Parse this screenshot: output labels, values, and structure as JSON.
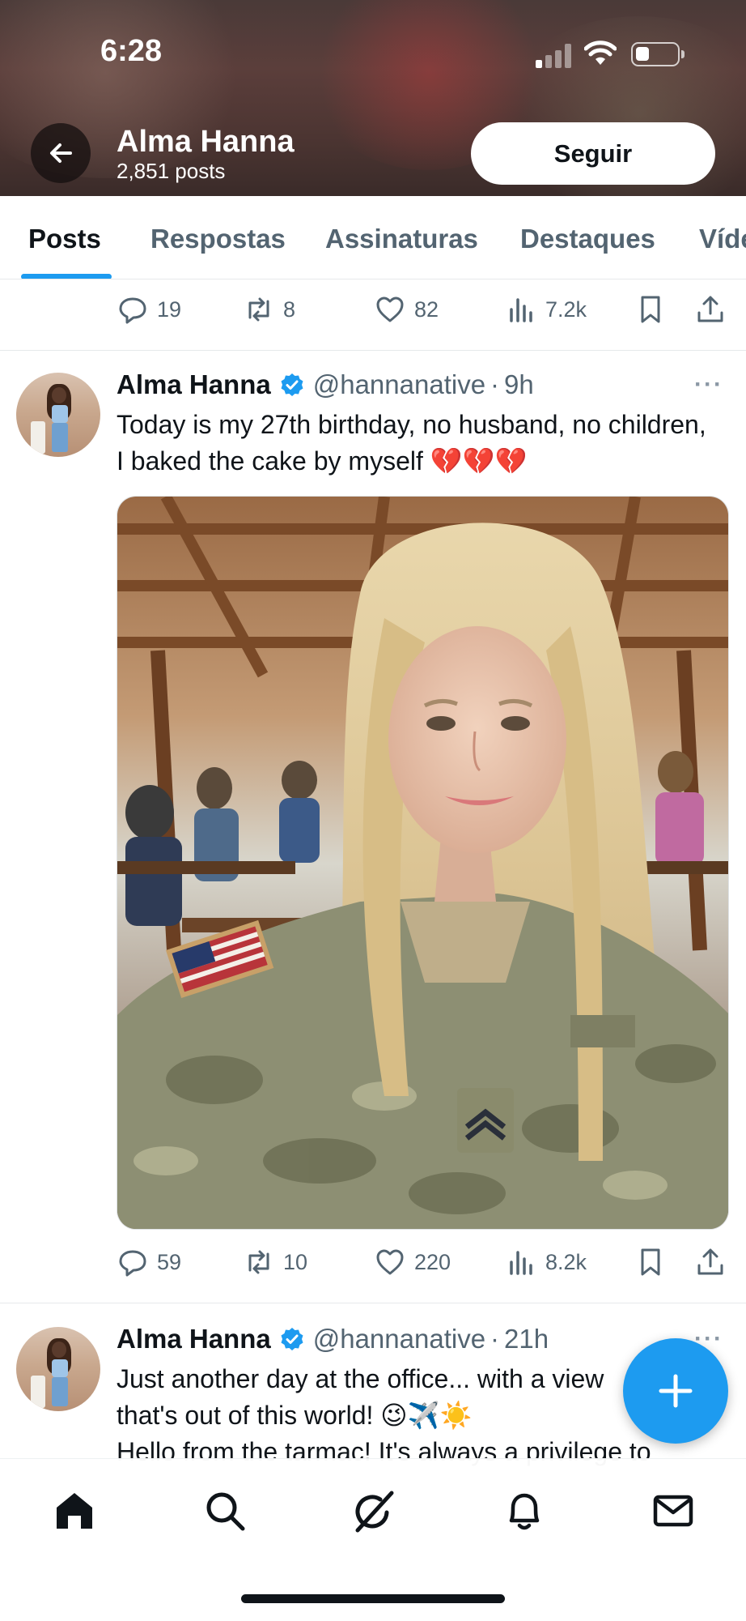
{
  "status_bar": {
    "time": "6:28"
  },
  "header": {
    "profile_name": "Alma Hanna",
    "post_count": "2,851 posts",
    "follow_label": "Seguir"
  },
  "tabs": [
    {
      "label": "Posts",
      "active": true
    },
    {
      "label": "Respostas",
      "active": false
    },
    {
      "label": "Assinaturas",
      "active": false
    },
    {
      "label": "Destaques",
      "active": false
    },
    {
      "label": "Víde",
      "active": false
    }
  ],
  "colors": {
    "accent": "#1d9bf0",
    "text": "#0f1419",
    "muted": "#536471"
  },
  "prev_tweet_actions": {
    "replies": "19",
    "reposts": "8",
    "likes": "82",
    "views": "7.2k"
  },
  "tweets": [
    {
      "name": "Alma Hanna",
      "verified": true,
      "handle": "@hannanative",
      "dot": "·",
      "time": "9h",
      "more": "···",
      "text": "Today is my 27th birthday, no husband, no children, I baked the cake by myself 💔💔💔",
      "media_icon": "photo-selfie-uniform",
      "actions": {
        "replies": "59",
        "reposts": "10",
        "likes": "220",
        "views": "8.2k"
      }
    },
    {
      "name": "Alma Hanna",
      "verified": true,
      "handle": "@hannanative",
      "dot": "·",
      "time": "21h",
      "more": "···",
      "text_line1": "Just another day at the office... with a view",
      "text_line2": "that's out of this world! 😉✈️☀️",
      "text_line3": "Hello from the tarmac! It's always a privilege to"
    }
  ],
  "fab": {
    "icon": "plus-icon"
  },
  "bottom_nav": [
    "home-icon",
    "search-icon",
    "grok-icon",
    "bell-icon",
    "mail-icon"
  ]
}
